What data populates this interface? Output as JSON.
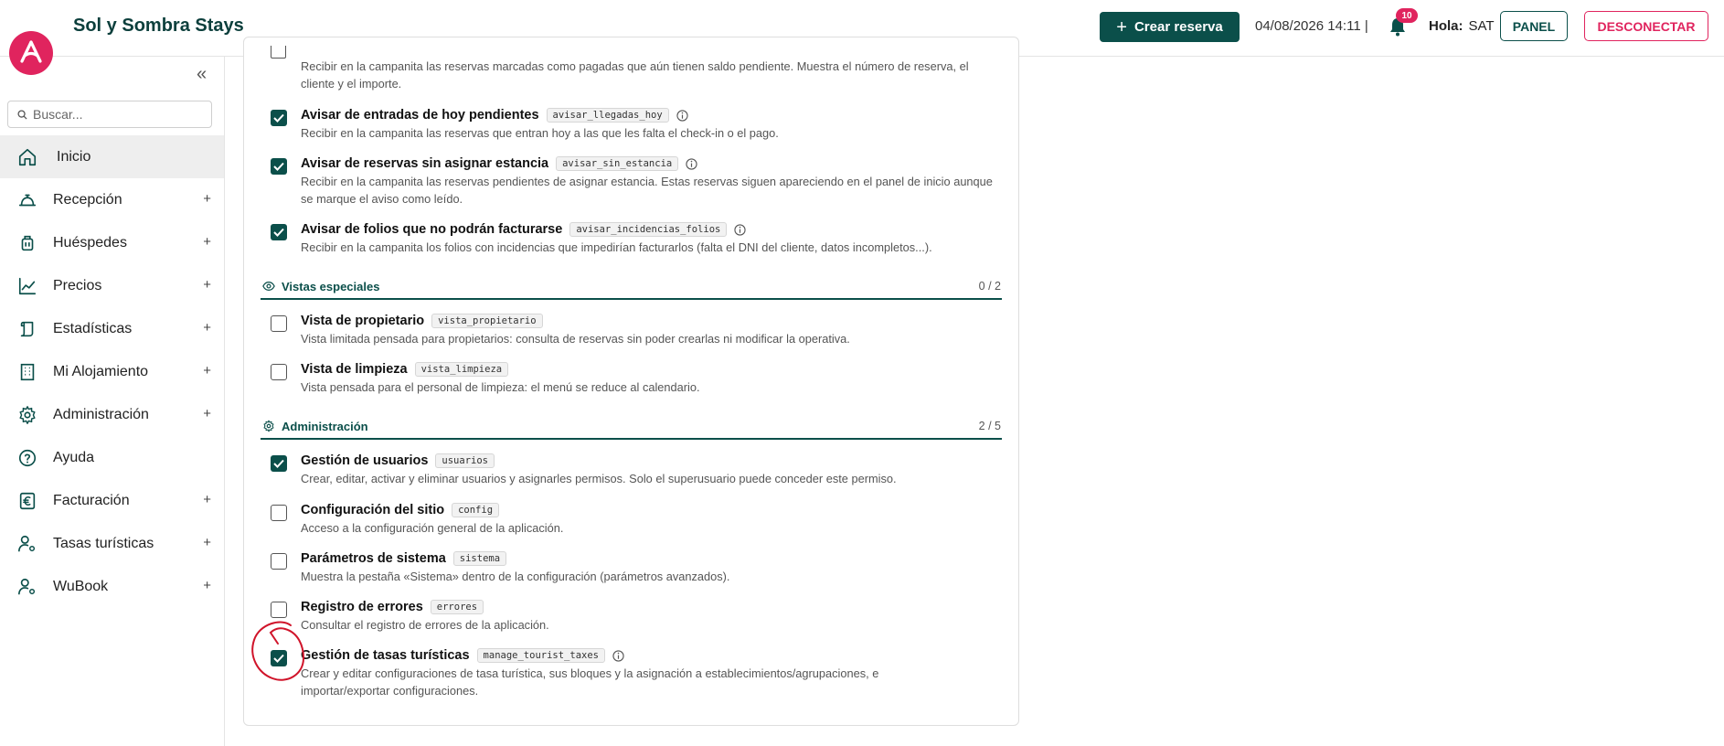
{
  "app": {
    "brand": "Sol y Sombra Stays",
    "create_label": "Crear reserva",
    "datetime": "04/08/2026 14:11 |",
    "notifications_count": "10",
    "greeting": "Hola:",
    "username": "SAT",
    "panel_label": "PANEL",
    "logout_label": "DESCONECTAR",
    "accent_color": "#0b4f4a",
    "brand_color": "#e0245e"
  },
  "sidebar": {
    "search_placeholder": "Buscar...",
    "items": [
      {
        "label": "Inicio",
        "icon": "home-icon",
        "expandable": false,
        "active": true
      },
      {
        "label": "Recepción",
        "icon": "bell-desk-icon",
        "expandable": true
      },
      {
        "label": "Huéspedes",
        "icon": "luggage-icon",
        "expandable": true
      },
      {
        "label": "Precios",
        "icon": "line-chart-icon",
        "expandable": true
      },
      {
        "label": "Estadísticas",
        "icon": "scroll-icon",
        "expandable": true
      },
      {
        "label": "Mi Alojamiento",
        "icon": "building-icon",
        "expandable": true
      },
      {
        "label": "Administración",
        "icon": "gear-icon",
        "expandable": true
      },
      {
        "label": "Ayuda",
        "icon": "help-circle-icon",
        "expandable": false
      },
      {
        "label": "Facturación",
        "icon": "euro-icon",
        "expandable": true
      },
      {
        "label": "Tasas turísticas",
        "icon": "user-settings-icon",
        "expandable": true
      },
      {
        "label": "WuBook",
        "icon": "user-settings-icon",
        "expandable": true
      }
    ],
    "expand_symbol": "+"
  },
  "permissions": {
    "top_partial_desc": "Recibir en la campanita las reservas marcadas como pagadas que aún tienen saldo pendiente. Muestra el número de reserva, el cliente y el importe.",
    "notify_rows": [
      {
        "title": "Avisar de entradas de hoy pendientes",
        "code": "avisar_llegadas_hoy",
        "info": true,
        "checked": true,
        "desc": "Recibir en la campanita las reservas que entran hoy a las que les falta el check-in o el pago."
      },
      {
        "title": "Avisar de reservas sin asignar estancia",
        "code": "avisar_sin_estancia",
        "info": true,
        "checked": true,
        "desc": "Recibir en la campanita las reservas pendientes de asignar estancia. Estas reservas siguen apareciendo en el panel de inicio aunque se marque el aviso como leído."
      },
      {
        "title": "Avisar de folios que no podrán facturarse",
        "code": "avisar_incidencias_folios",
        "info": true,
        "checked": true,
        "desc": "Recibir en la campanita los folios con incidencias que impedirían facturarlos (falta el DNI del cliente, datos incompletos...)."
      }
    ],
    "special_section": {
      "title": "Vistas especiales",
      "count": "0 / 2",
      "icon": "eye-icon"
    },
    "special_rows": [
      {
        "title": "Vista de propietario",
        "code": "vista_propietario",
        "info": false,
        "checked": false,
        "desc": "Vista limitada pensada para propietarios: consulta de reservas sin poder crearlas ni modificar la operativa."
      },
      {
        "title": "Vista de limpieza",
        "code": "vista_limpieza",
        "info": false,
        "checked": false,
        "desc": "Vista pensada para el personal de limpieza: el menú se reduce al calendario."
      }
    ],
    "admin_section": {
      "title": "Administración",
      "count": "2 / 5",
      "icon": "gear-icon"
    },
    "admin_rows": [
      {
        "title": "Gestión de usuarios",
        "code": "usuarios",
        "info": false,
        "checked": true,
        "desc": "Crear, editar, activar y eliminar usuarios y asignarles permisos. Solo el superusuario puede conceder este permiso."
      },
      {
        "title": "Configuración del sitio",
        "code": "config",
        "info": false,
        "checked": false,
        "desc": "Acceso a la configuración general de la aplicación."
      },
      {
        "title": "Parámetros de sistema",
        "code": "sistema",
        "info": false,
        "checked": false,
        "desc": "Muestra la pestaña «Sistema» dentro de la configuración (parámetros avanzados)."
      },
      {
        "title": "Registro de errores",
        "code": "errores",
        "info": false,
        "checked": false,
        "desc": "Consultar el registro de errores de la aplicación."
      },
      {
        "title": "Gestión de tasas turísticas",
        "code": "manage_tourist_taxes",
        "info": true,
        "checked": true,
        "desc": "Crear y editar configuraciones de tasa turística, sus bloques y la asignación a establecimientos/agrupaciones, e importar/exportar configuraciones."
      }
    ]
  }
}
